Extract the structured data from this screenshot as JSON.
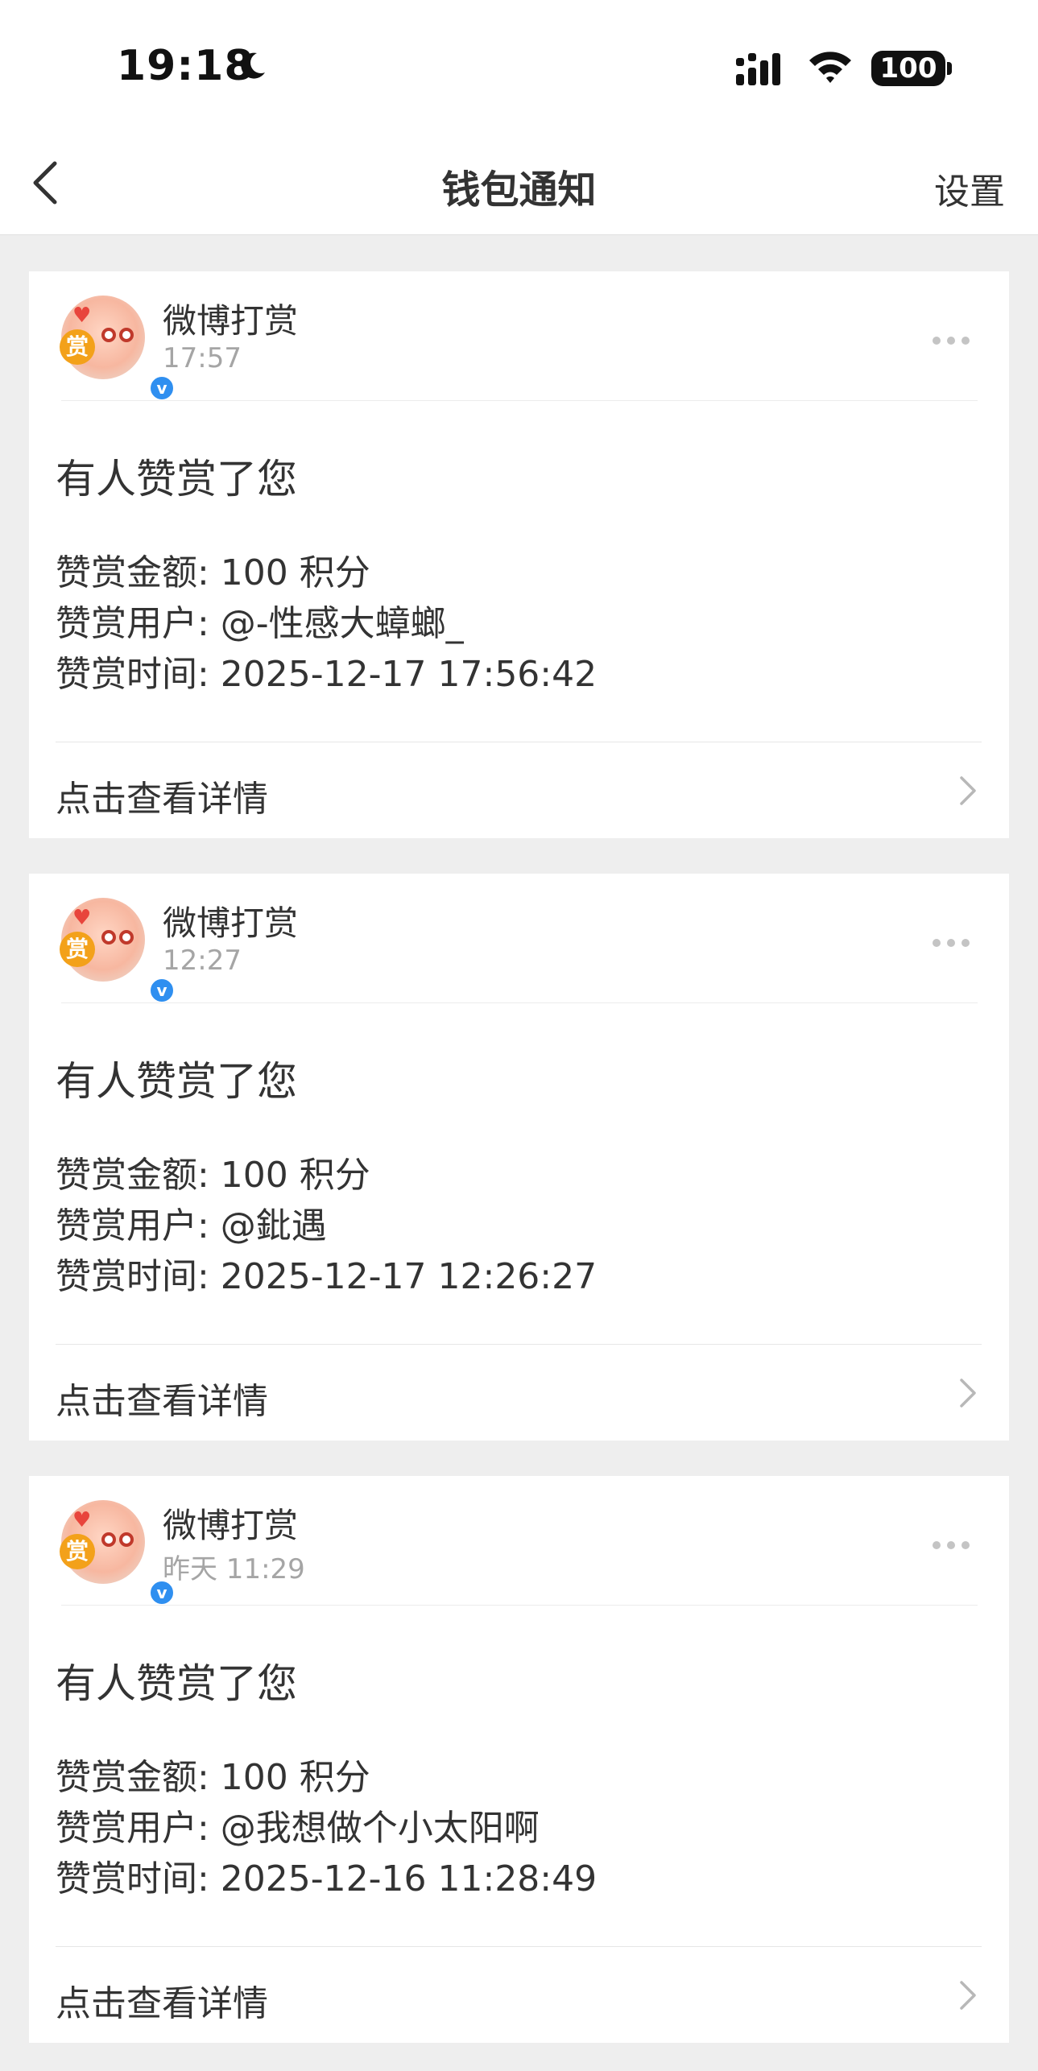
{
  "status_bar": {
    "time": "19:18",
    "battery": "100"
  },
  "nav": {
    "title": "钱包通知",
    "settings_label": "设置"
  },
  "notifications": [
    {
      "sender": "微博打赏",
      "time": "17:57",
      "title": "有人赞赏了您",
      "amount": "赞赏金额: 100 积分",
      "user": "赞赏用户: @-性感大蟑螂_",
      "datetime": "赞赏时间: 2025-12-17 17:56:42",
      "detail_label": "点击查看详情"
    },
    {
      "sender": "微博打赏",
      "time": "12:27",
      "title": "有人赞赏了您",
      "amount": "赞赏金额: 100 积分",
      "user": "赞赏用户: @鈚遇",
      "datetime": "赞赏时间: 2025-12-17 12:26:27",
      "detail_label": "点击查看详情"
    },
    {
      "sender": "微博打赏",
      "time": "昨天 11:29",
      "title": "有人赞赏了您",
      "amount": "赞赏金额: 100 积分",
      "user": "赞赏用户: @我想做个小太阳啊",
      "datetime": "赞赏时间: 2025-12-16 11:28:49",
      "detail_label": "点击查看详情"
    }
  ],
  "avatar": {
    "badge_text": "赏",
    "verified_mark": "v",
    "heart_glyph": "♥"
  },
  "icons": {
    "back": "chevron-left-icon",
    "more": "more-dots-icon",
    "detail": "chevron-right-icon",
    "moon": "moon-icon",
    "signal": "signal-icon",
    "wifi": "wifi-icon",
    "verified": "verified-icon"
  },
  "colors": {
    "background": "#eeeeee",
    "card": "#ffffff",
    "verified": "#2f8ff0",
    "badge": "#f3a11a",
    "secondary_text": "#a5a5a5"
  }
}
